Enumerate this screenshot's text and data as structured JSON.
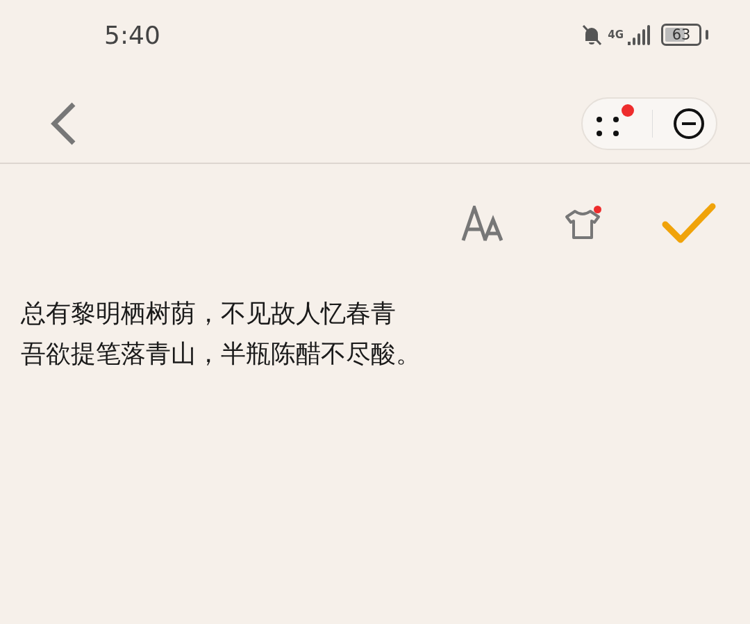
{
  "status_bar": {
    "time": "5:40",
    "network": "4G",
    "battery": "63"
  },
  "header": {
    "menu_badge": true
  },
  "toolbar": {
    "theme_badge": true
  },
  "note": {
    "lines": [
      "总有黎明栖树荫，不见故人忆春青",
      "吾欲提笔落青山，半瓶陈醋不尽酸。"
    ]
  }
}
